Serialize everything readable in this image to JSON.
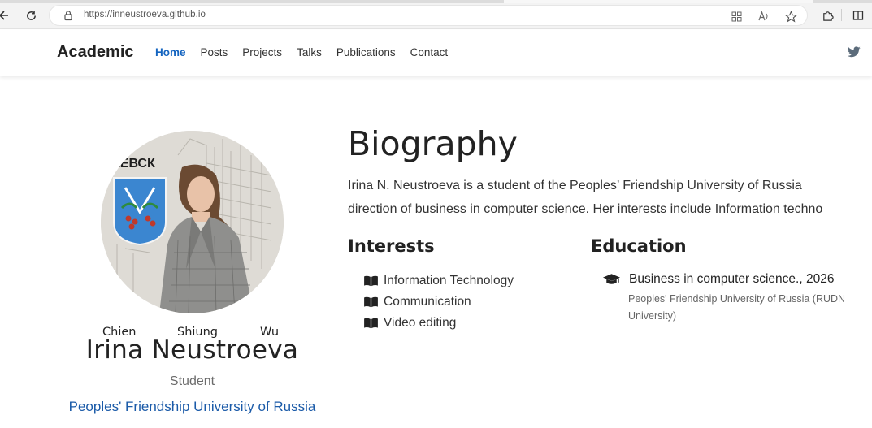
{
  "browser": {
    "url": "https://inneustroeva.github.io"
  },
  "navbar": {
    "brand": "Academic",
    "links": [
      {
        "label": "Home",
        "active": true
      },
      {
        "label": "Posts",
        "active": false
      },
      {
        "label": "Projects",
        "active": false
      },
      {
        "label": "Talks",
        "active": false
      },
      {
        "label": "Publications",
        "active": false
      },
      {
        "label": "Contact",
        "active": false
      }
    ],
    "social_icon": "twitter-icon"
  },
  "profile": {
    "avatar_sign_text": "КЕВСК",
    "alt_names": [
      "Chien",
      "Shiung",
      "Wu"
    ],
    "name": "Irina Neustroeva",
    "role": "Student",
    "organization": "Peoples' Friendship University of Russia"
  },
  "biography": {
    "title": "Biography",
    "lines": [
      "Irina N. Neustroeva is a student of the Peoples’ Friendship University of Russia",
      "direction of business in computer science. Her interests include Information techno"
    ]
  },
  "interests": {
    "title": "Interests",
    "items": [
      "Information Technology",
      "Communication",
      "Video editing"
    ]
  },
  "education": {
    "title": "Education",
    "items": [
      {
        "degree": "Business in computer science., 2026",
        "school": "Peoples' Friendship University of Russia (RUDN University)"
      }
    ]
  },
  "colors": {
    "accent": "#1565c0",
    "org_link": "#1a5aa8"
  }
}
